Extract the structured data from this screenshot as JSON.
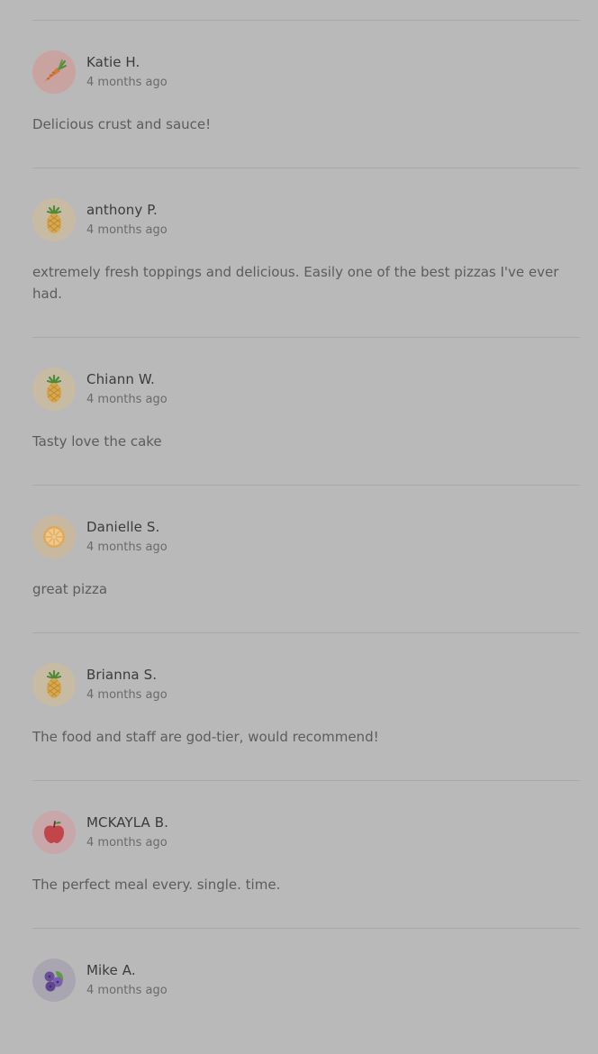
{
  "reviews": [
    {
      "name": "Katie H.",
      "time": "4 months ago",
      "text": "Delicious crust and sauce!",
      "avatar_icon": "carrot-icon",
      "avatar_bg": "#c9a3a0"
    },
    {
      "name": "anthony P.",
      "time": "4 months ago",
      "text": "extremely fresh toppings and delicious. Easily one of the best pizzas I've ever had.",
      "avatar_icon": "pineapple-icon",
      "avatar_bg": "#c7bba3"
    },
    {
      "name": "Chiann W.",
      "time": "4 months ago",
      "text": "Tasty love the cake",
      "avatar_icon": "pineapple-icon",
      "avatar_bg": "#c7bba3"
    },
    {
      "name": "Danielle S.",
      "time": "4 months ago",
      "text": "great pizza",
      "avatar_icon": "orange-slice-icon",
      "avatar_bg": "#c9b8a0"
    },
    {
      "name": "Brianna S.",
      "time": "4 months ago",
      "text": "The food and staff are god-tier, would recommend!",
      "avatar_icon": "pineapple-icon",
      "avatar_bg": "#c7bba3"
    },
    {
      "name": "MCKAYLA B.",
      "time": "4 months ago",
      "text": "The perfect meal every. single. time.",
      "avatar_icon": "apple-icon",
      "avatar_bg": "#c7a7a9"
    },
    {
      "name": "Mike A.",
      "time": "4 months ago",
      "text": "",
      "avatar_icon": "blueberries-icon",
      "avatar_bg": "#a9a6b1"
    }
  ]
}
